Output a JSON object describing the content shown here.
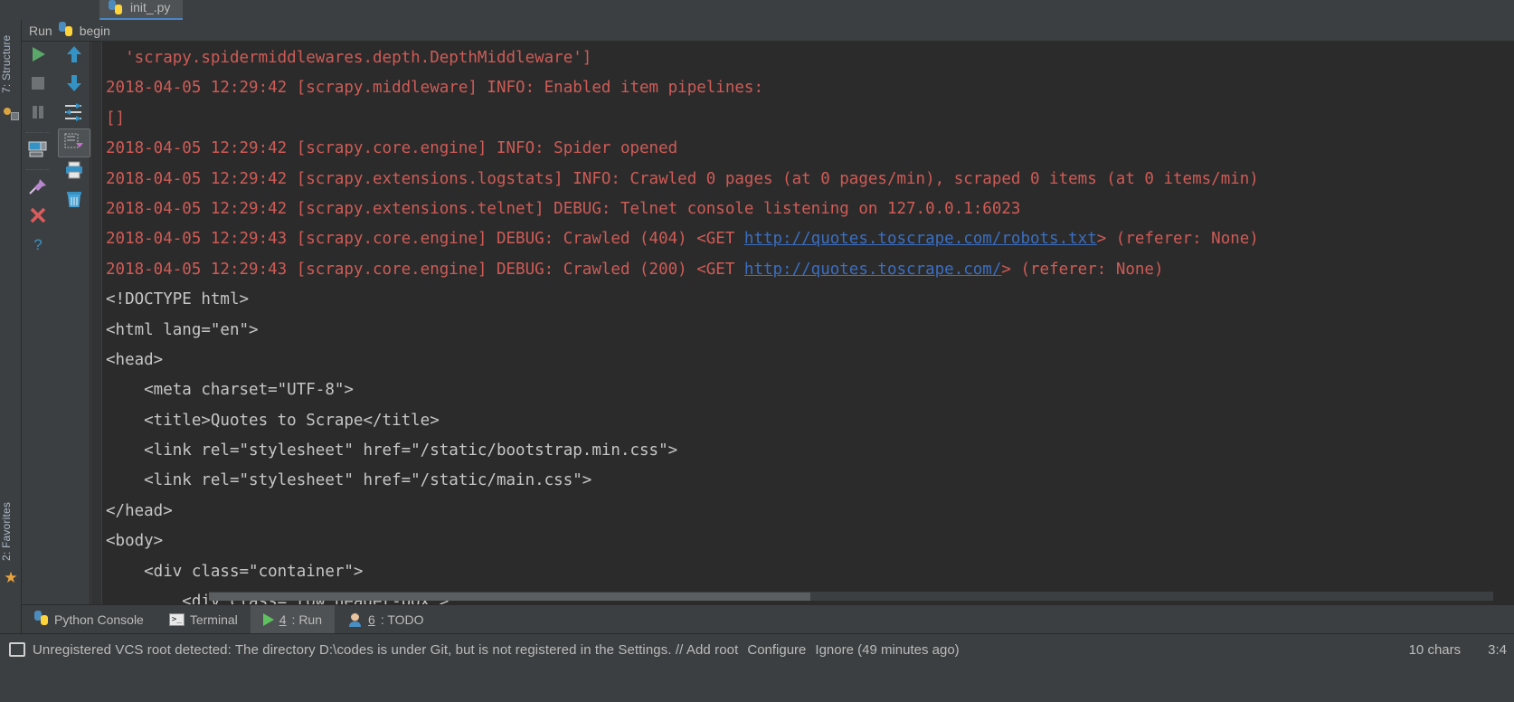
{
  "editor_tab": {
    "label": "init_.py",
    "icon": "python-file-icon"
  },
  "left_rail": {
    "structure_tab": "7: Structure",
    "favorites_tab": "2: Favorites",
    "star_icon": "star-icon"
  },
  "run_window": {
    "title": "Run",
    "config_name": "begin",
    "config_icon": "python-run-config-icon",
    "toolbar_left": [
      {
        "name": "rerun-button",
        "icon": "green-play-icon"
      },
      {
        "name": "stop-button",
        "icon": "stop-square-icon"
      },
      {
        "name": "pause-button",
        "icon": "pause-icon"
      },
      {
        "name": "show-console-button",
        "icon": "console-icon"
      },
      {
        "name": "pin-tab-button",
        "icon": "pin-icon"
      },
      {
        "name": "close-button",
        "icon": "close-x-icon"
      },
      {
        "name": "help-button",
        "icon": "question-mark-icon"
      }
    ],
    "toolbar_right": [
      {
        "name": "up-stack-trace-button",
        "icon": "arrow-up-icon"
      },
      {
        "name": "down-stack-trace-button",
        "icon": "arrow-down-icon"
      },
      {
        "name": "soft-wrap-button",
        "icon": "soft-wrap-icon"
      },
      {
        "name": "scroll-to-end-button",
        "icon": "scroll-to-end-icon"
      },
      {
        "name": "print-button",
        "icon": "printer-icon"
      },
      {
        "name": "clear-all-button",
        "icon": "trash-icon"
      }
    ]
  },
  "console": {
    "lines": [
      {
        "type": "err",
        "text": "  'scrapy.spidermiddlewares.depth.DepthMiddleware']"
      },
      {
        "type": "err",
        "text": "2018-04-05 12:29:42 [scrapy.middleware] INFO: Enabled item pipelines:"
      },
      {
        "type": "err",
        "text": "[]"
      },
      {
        "type": "err",
        "text": "2018-04-05 12:29:42 [scrapy.core.engine] INFO: Spider opened"
      },
      {
        "type": "err",
        "text": "2018-04-05 12:29:42 [scrapy.extensions.logstats] INFO: Crawled 0 pages (at 0 pages/min), scraped 0 items (at 0 items/min)"
      },
      {
        "type": "err",
        "text": "2018-04-05 12:29:42 [scrapy.extensions.telnet] DEBUG: Telnet console listening on 127.0.0.1:6023"
      },
      {
        "type": "err-link",
        "pre": "2018-04-05 12:29:43 [scrapy.core.engine] DEBUG: Crawled (404) <GET ",
        "link": "http://quotes.toscrape.com/robots.txt",
        "post": "> (referer: None)"
      },
      {
        "type": "err-link",
        "pre": "2018-04-05 12:29:43 [scrapy.core.engine] DEBUG: Crawled (200) <GET ",
        "link": "http://quotes.toscrape.com/",
        "post": "> (referer: None)"
      },
      {
        "type": "out",
        "text": "<!DOCTYPE html>"
      },
      {
        "type": "out",
        "text": "<html lang=\"en\">"
      },
      {
        "type": "out",
        "text": "<head>"
      },
      {
        "type": "out",
        "text": "    <meta charset=\"UTF-8\">"
      },
      {
        "type": "out",
        "text": "    <title>Quotes to Scrape</title>"
      },
      {
        "type": "out",
        "text": "    <link rel=\"stylesheet\" href=\"/static/bootstrap.min.css\">"
      },
      {
        "type": "out",
        "text": "    <link rel=\"stylesheet\" href=\"/static/main.css\">"
      },
      {
        "type": "out",
        "text": "</head>"
      },
      {
        "type": "out",
        "text": "<body>"
      },
      {
        "type": "out",
        "text": "    <div class=\"container\">"
      },
      {
        "type": "out",
        "text": "        <div class=\"row header-box\">"
      }
    ],
    "colors": {
      "stderr": "#cf5b56",
      "stdout": "#c6c6c6",
      "link": "#3b6ec1",
      "background": "#2b2b2b"
    }
  },
  "bottom_tabs": [
    {
      "label": "Python Console",
      "icon": "python-console-icon",
      "active": false,
      "num": ""
    },
    {
      "label": "Terminal",
      "icon": "terminal-icon",
      "active": false,
      "num": ""
    },
    {
      "label": ": Run",
      "num": "4",
      "icon": "green-play-icon",
      "active": true
    },
    {
      "label": ": TODO",
      "num": "6",
      "icon": "todo-person-icon",
      "active": false
    }
  ],
  "statusbar": {
    "vcs_icon": "vcs-root-icon",
    "message": "Unregistered VCS root detected: The directory D:\\codes is under Git, but is not registered in the Settings. // Add root",
    "link_configure": "Configure",
    "link_ignore": "Ignore (49 minutes ago)",
    "chars": "10 chars",
    "caret": "3:4"
  }
}
